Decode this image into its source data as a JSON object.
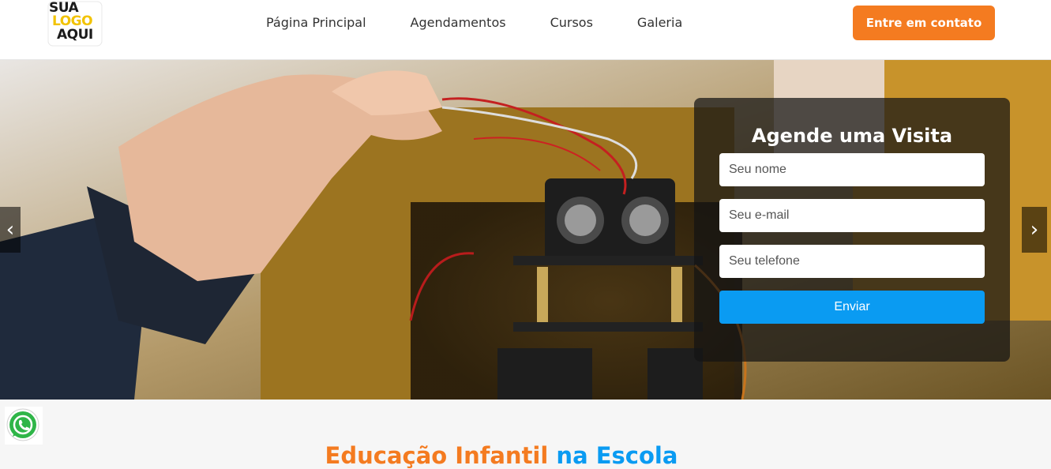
{
  "header": {
    "logo": {
      "lines": [
        "SUA",
        "LOGO",
        "AQUI"
      ]
    },
    "nav": [
      {
        "label": "Página Principal"
      },
      {
        "label": "Agendamentos"
      },
      {
        "label": "Cursos"
      },
      {
        "label": "Galeria"
      }
    ],
    "cta_label": "Entre em contato"
  },
  "hero": {
    "prev_icon": "‹",
    "next_icon": "›",
    "form": {
      "title": "Agende uma Visita",
      "name_placeholder": "Seu nome",
      "email_placeholder": "Seu e-mail",
      "phone_placeholder": "Seu telefone",
      "submit_label": "Enviar"
    }
  },
  "section": {
    "title_part1": "Educação Infantil",
    "title_part2": "na Escola"
  },
  "colors": {
    "accent_orange": "#f47b20",
    "accent_blue": "#0a9bf2"
  },
  "icons": {
    "whatsapp": "whatsapp-icon"
  }
}
